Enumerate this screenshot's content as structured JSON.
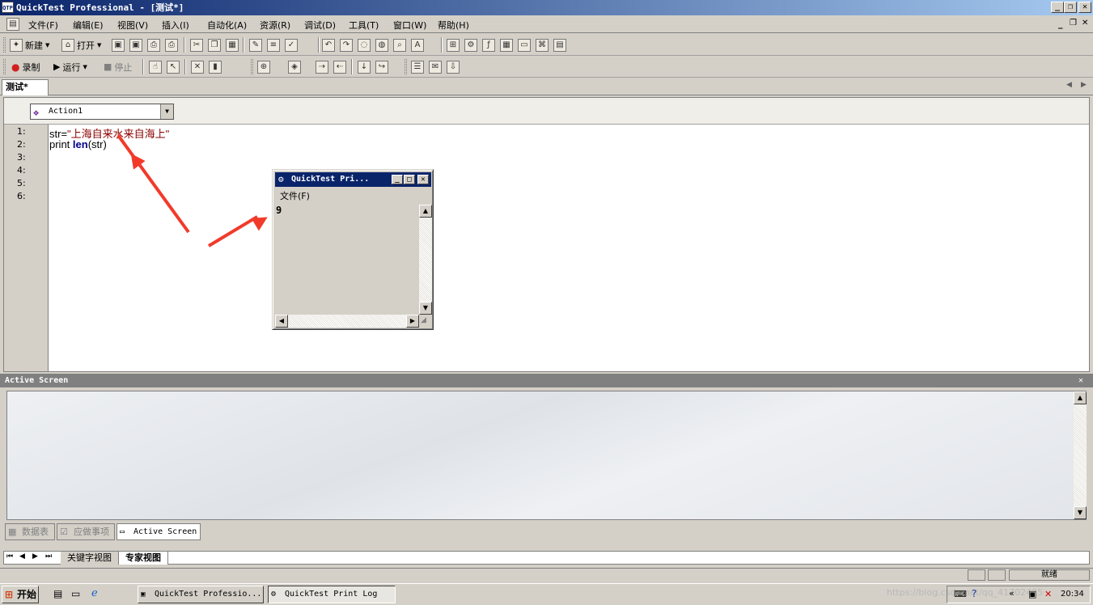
{
  "window": {
    "title": "QuickTest Professional - [测试*]",
    "app_icon_text": "QTP",
    "controls": {
      "minimize": "_",
      "restore": "❐",
      "close": "✕"
    }
  },
  "menu": {
    "items": [
      "文件(F)",
      "编辑(E)",
      "视图(V)",
      "插入(I)",
      "自动化(A)",
      "资源(R)",
      "调试(D)",
      "工具(T)",
      "窗口(W)",
      "帮助(H)"
    ],
    "mdi_controls": {
      "minimize": "_",
      "restore": "❐",
      "close": "✕"
    }
  },
  "toolbar1": {
    "new_label": "新建",
    "open_label": "打开"
  },
  "toolbar2": {
    "record_label": "录制",
    "run_label": "运行",
    "stop_label": "停止"
  },
  "document": {
    "tab_label": "测试*"
  },
  "editor": {
    "action_selector_value": "Action1",
    "line_numbers": [
      "1:",
      "2:",
      "3:",
      "4:",
      "5:",
      "6:"
    ],
    "code_lines": [
      {
        "pre": "str=",
        "string": "\"上海自来水来自海上\""
      },
      {
        "pre": "print ",
        "keyword": "len",
        "post": "(str)"
      }
    ]
  },
  "print_log": {
    "title": "QuickTest Pri...",
    "menu_file": "文件(F)",
    "output": "9"
  },
  "active_screen": {
    "title": "Active Screen",
    "close": "✕"
  },
  "bottom_tabs": [
    "数据表",
    "应做事项",
    "Active Screen"
  ],
  "view_tabs": [
    "关键字视图",
    "专家视图"
  ],
  "status": {
    "text": "就绪"
  },
  "taskbar": {
    "start_label": "开始",
    "tasks": [
      "QuickTest Professio...",
      "QuickTest Print Log"
    ],
    "clock": "20:34",
    "watermark": "https://blog.csdn.net/qq_41702425"
  }
}
